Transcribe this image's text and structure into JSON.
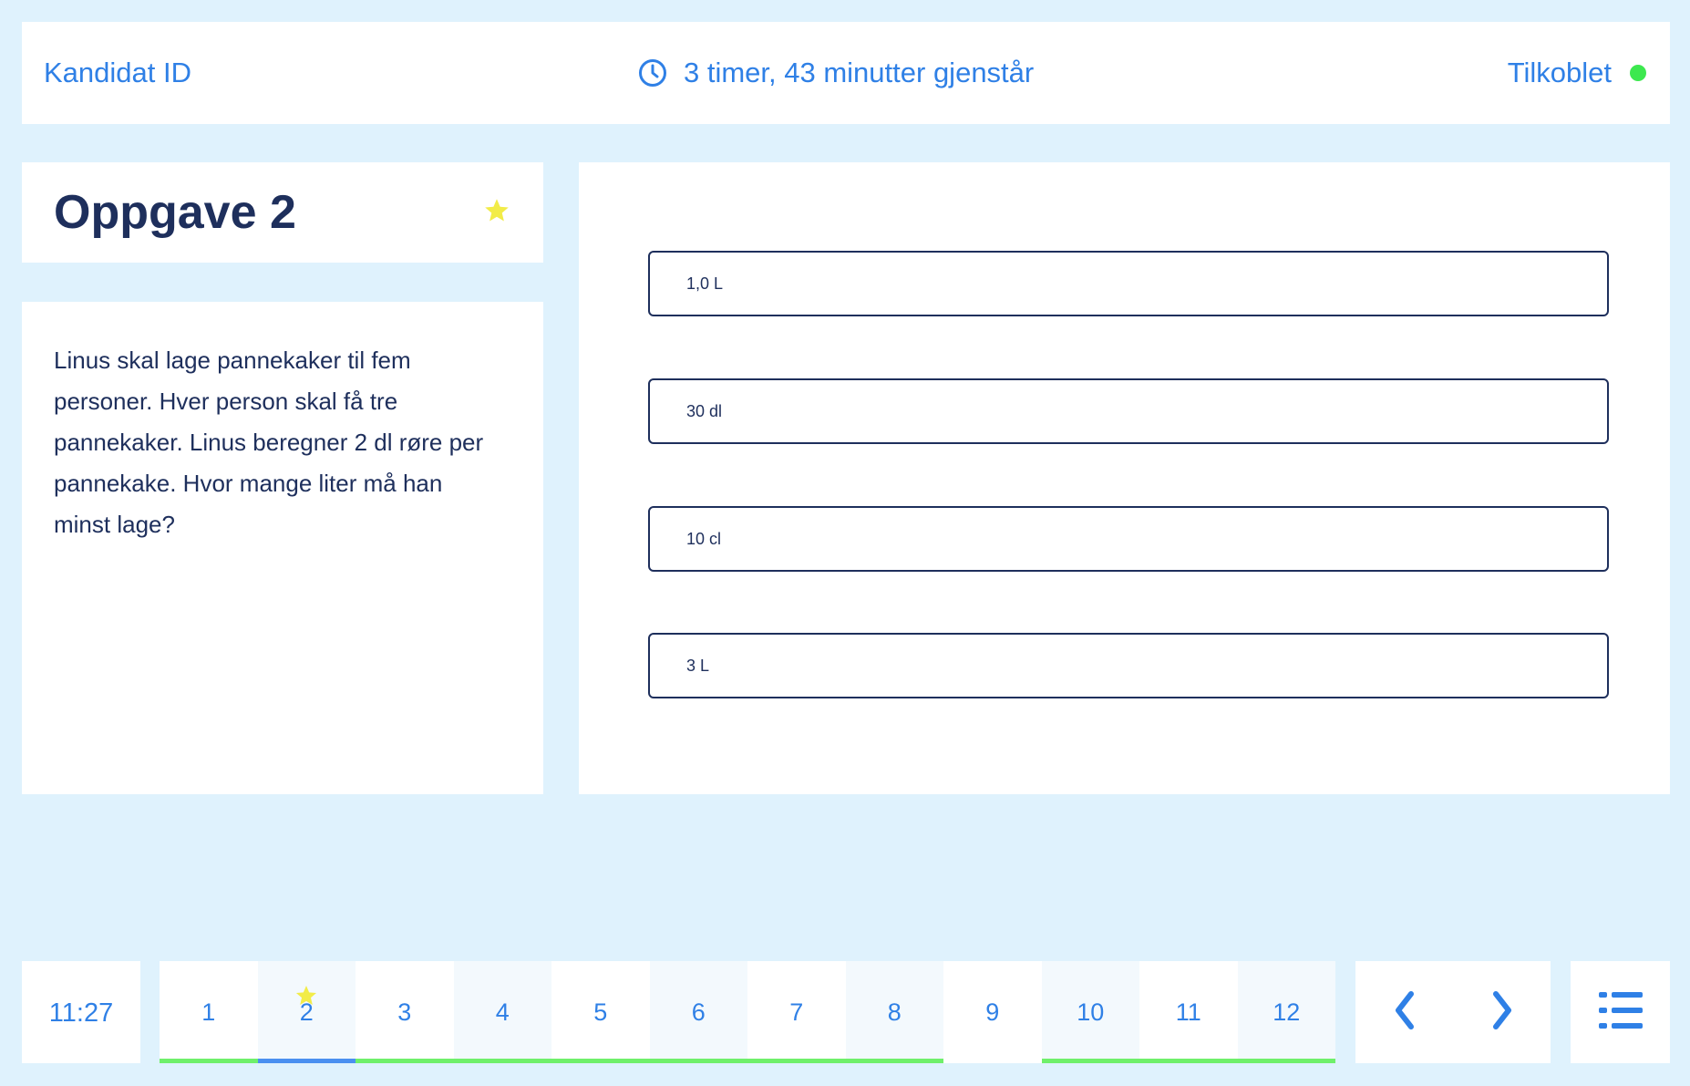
{
  "header": {
    "candidate_label": "Kandidat ID",
    "timer_text": "3 timer,  43 minutter gjenstår",
    "status_text": "Tilkoblet",
    "status_color": "#3de84f"
  },
  "question": {
    "title": "Oppgave 2",
    "starred": true,
    "text": "Linus skal lage pannekaker til fem personer. Hver person skal få tre pannekaker. Linus beregner 2 dl røre per pannekake. Hvor mange liter må han minst lage?"
  },
  "answers": [
    {
      "label": "1,0 L"
    },
    {
      "label": "30 dl"
    },
    {
      "label": "10 cl"
    },
    {
      "label": "3 L"
    }
  ],
  "footer": {
    "clock": "11:27",
    "questions": [
      {
        "number": "1",
        "status": "answered"
      },
      {
        "number": "2",
        "status": "current",
        "starred": true
      },
      {
        "number": "3",
        "status": "answered"
      },
      {
        "number": "4",
        "status": "answered"
      },
      {
        "number": "5",
        "status": "answered"
      },
      {
        "number": "6",
        "status": "answered"
      },
      {
        "number": "7",
        "status": "answered"
      },
      {
        "number": "8",
        "status": "answered"
      },
      {
        "number": "9",
        "status": "unanswered"
      },
      {
        "number": "10",
        "status": "answered"
      },
      {
        "number": "11",
        "status": "answered"
      },
      {
        "number": "12",
        "status": "answered"
      }
    ],
    "prev_icon": "chevron-left-icon",
    "next_icon": "chevron-right-icon",
    "menu_icon": "list-menu-icon"
  },
  "colors": {
    "accent": "#2f80e6",
    "answered": "#6ff06b",
    "current": "#4a90f0",
    "star": "#f2ec48",
    "text_dark": "#1e2f5c",
    "background": "#dff2fd"
  }
}
